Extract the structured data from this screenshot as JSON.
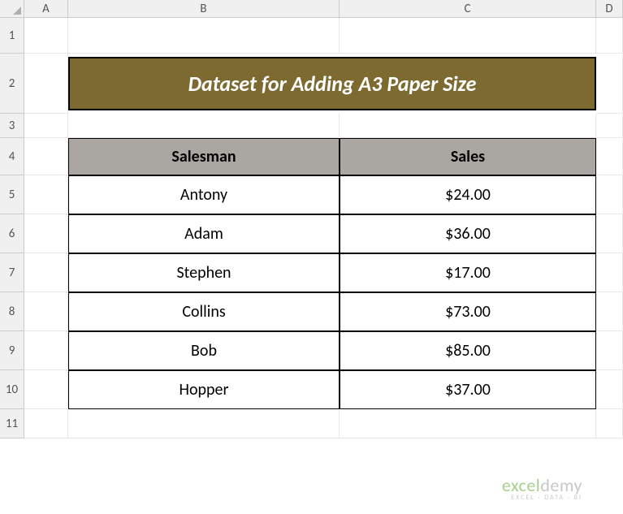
{
  "columns": [
    "A",
    "B",
    "C",
    "D"
  ],
  "rows": [
    "1",
    "2",
    "3",
    "4",
    "5",
    "6",
    "7",
    "8",
    "9",
    "10",
    "11"
  ],
  "title": "Dataset for Adding A3 Paper Size",
  "headers": {
    "col1": "Salesman",
    "col2": "Sales"
  },
  "data": [
    {
      "name": "Antony",
      "sales": "$24.00"
    },
    {
      "name": "Adam",
      "sales": "$36.00"
    },
    {
      "name": "Stephen",
      "sales": "$17.00"
    },
    {
      "name": "Collins",
      "sales": "$73.00"
    },
    {
      "name": "Bob",
      "sales": "$85.00"
    },
    {
      "name": "Hopper",
      "sales": "$37.00"
    }
  ],
  "watermark": {
    "brand_pre": "excel",
    "brand_suf": "demy",
    "tag": "EXCEL · DATA · BI"
  },
  "chart_data": {
    "type": "table",
    "title": "Dataset for Adding A3 Paper Size",
    "columns": [
      "Salesman",
      "Sales"
    ],
    "rows": [
      [
        "Antony",
        24.0
      ],
      [
        "Adam",
        36.0
      ],
      [
        "Stephen",
        17.0
      ],
      [
        "Collins",
        73.0
      ],
      [
        "Bob",
        85.0
      ],
      [
        "Hopper",
        37.0
      ]
    ]
  }
}
